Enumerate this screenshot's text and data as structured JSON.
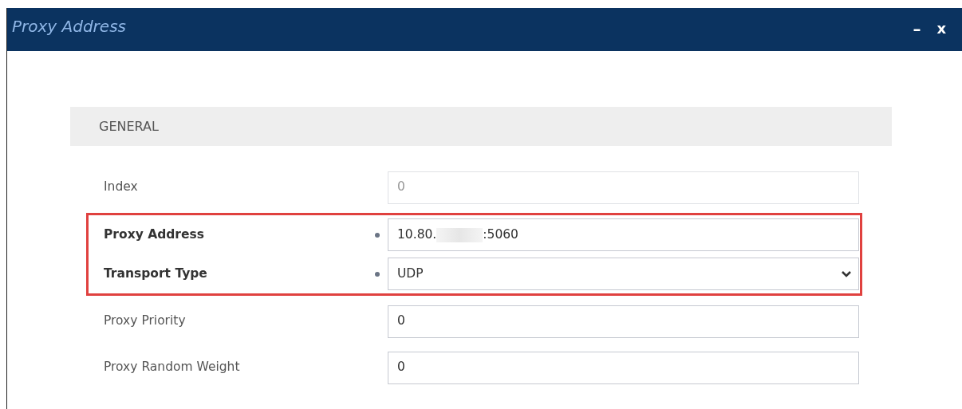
{
  "window": {
    "title": "Proxy Address",
    "controls": [
      {
        "kind": "minimize",
        "label": "–"
      },
      {
        "kind": "close",
        "label": "x"
      }
    ]
  },
  "section": {
    "title": "GENERAL"
  },
  "fields": [
    {
      "label": "Index",
      "kind": "input",
      "value_parts": [
        "0"
      ],
      "disabled": true,
      "modified": false,
      "highlighted": false
    },
    {
      "label": "Proxy Address",
      "kind": "input",
      "value_parts": [
        "10.80.",
        ":5060"
      ],
      "redacted": true,
      "disabled": false,
      "modified": true,
      "highlighted": true
    },
    {
      "label": "Transport Type",
      "kind": "select",
      "value_parts": [
        "UDP"
      ],
      "disabled": false,
      "modified": true,
      "highlighted": true
    },
    {
      "label": "Proxy Priority",
      "kind": "input",
      "value_parts": [
        "0"
      ],
      "disabled": false,
      "modified": false,
      "highlighted": false
    },
    {
      "label": "Proxy Random Weight",
      "kind": "input",
      "value_parts": [
        "0"
      ],
      "disabled": false,
      "modified": false,
      "highlighted": false
    }
  ]
}
